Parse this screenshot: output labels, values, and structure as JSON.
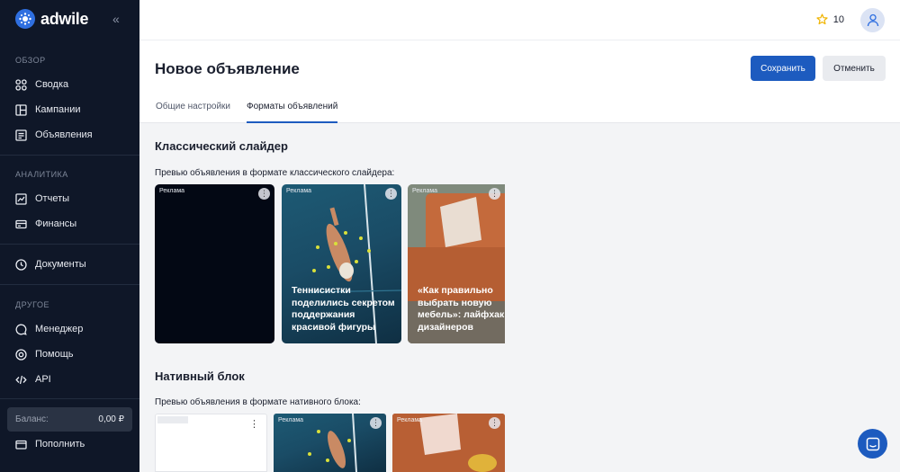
{
  "app": {
    "brand": "adwile"
  },
  "sidebar": {
    "sections": [
      {
        "title": "ОБЗОР",
        "items": [
          "Сводка",
          "Кампании",
          "Объявления"
        ]
      },
      {
        "title": "АНАЛИТИКА",
        "items": [
          "Отчеты",
          "Финансы"
        ]
      },
      {
        "title": "",
        "items": [
          "Документы"
        ]
      },
      {
        "title": "ДРУГОЕ",
        "items": [
          "Менеджер",
          "Помощь",
          "API"
        ]
      }
    ],
    "balance_label": "Баланс:",
    "balance_value": "0,00 ₽",
    "topup_label": "Пополнить"
  },
  "header": {
    "stars_count": "10"
  },
  "page": {
    "title": "Новое объявление",
    "save_label": "Сохранить",
    "cancel_label": "Отменить",
    "tabs": [
      {
        "label": "Общие настройки",
        "active": false
      },
      {
        "label": "Форматы объявлений",
        "active": true
      }
    ]
  },
  "slider_section": {
    "title": "Классический слайдер",
    "preview_label": "Превью объявления в формате классического слайдера:",
    "cards": [
      {
        "ad_label": "Реклама",
        "caption": ""
      },
      {
        "ad_label": "Реклама",
        "caption": "Теннисистки поделились секретом поддержания красивой фигуры"
      },
      {
        "ad_label": "Реклама",
        "caption": "«Как правильно выбрать новую мебель»: лайфхак от дизайнеров"
      }
    ]
  },
  "native_section": {
    "title": "Нативный блок",
    "preview_label": "Превью объявления в формате нативного блока:",
    "cards": [
      {
        "ad_label": ""
      },
      {
        "ad_label": "Реклама"
      },
      {
        "ad_label": "Реклама"
      }
    ]
  },
  "colors": {
    "accent": "#1d5bbf",
    "sidebar_bg": "#0f1728",
    "star": "#f0b400"
  },
  "icons": [
    "grid-icon",
    "layout-icon",
    "list-icon",
    "chart-icon",
    "finance-icon",
    "clock-icon",
    "chat-icon",
    "help-icon",
    "code-icon",
    "wallet-icon",
    "star-icon",
    "user-icon",
    "more-icon"
  ]
}
